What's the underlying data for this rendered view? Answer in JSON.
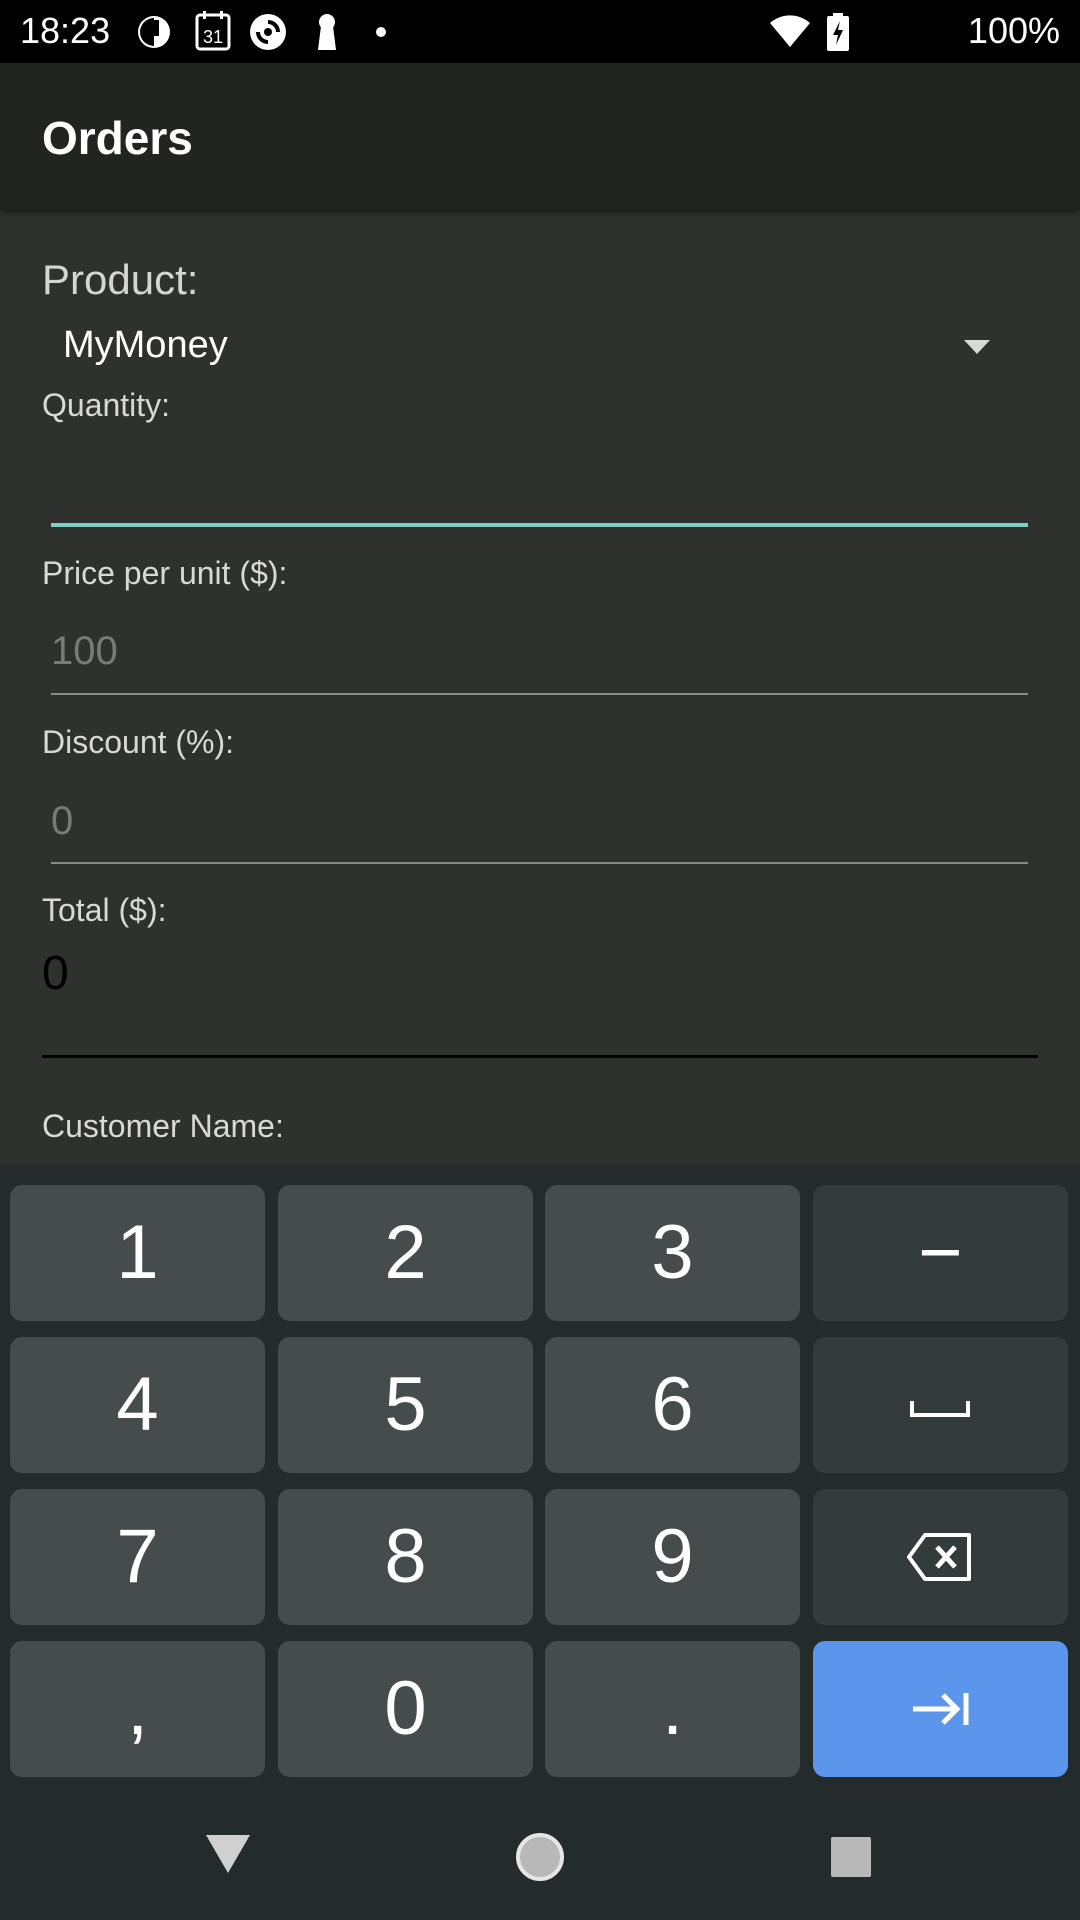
{
  "status_bar": {
    "time": "18:23",
    "battery": "100%",
    "left_icons": [
      "data-saver-icon",
      "calendar-icon",
      "sync-icon",
      "keyhole-icon",
      "notification-dot-icon"
    ],
    "calendar_day": "31",
    "right_icons": [
      "wifi-icon",
      "battery-charging-icon"
    ]
  },
  "app_bar": {
    "title": "Orders"
  },
  "form": {
    "product_label": "Product:",
    "product_value": "MyMoney",
    "quantity_label": "Quantity:",
    "quantity_value": "",
    "price_label": "Price per unit ($):",
    "price_hint": "100",
    "discount_label": "Discount (%):",
    "discount_hint": "0",
    "total_label": "Total ($):",
    "total_value": "0",
    "customer_label": "Customer Name:"
  },
  "keyboard": {
    "keys": [
      {
        "label": "1"
      },
      {
        "label": "2"
      },
      {
        "label": "3"
      },
      {
        "label": "−"
      },
      {
        "label": "4"
      },
      {
        "label": "5"
      },
      {
        "label": "6"
      },
      {
        "label": "space-icon"
      },
      {
        "label": "7"
      },
      {
        "label": "8"
      },
      {
        "label": "9"
      },
      {
        "label": "backspace-icon"
      },
      {
        "label": ","
      },
      {
        "label": "0"
      },
      {
        "label": "."
      },
      {
        "label": "next-tab-icon"
      }
    ]
  },
  "nav_bar": {
    "icons": [
      "back-icon",
      "home-icon",
      "recents-icon"
    ]
  },
  "colors": {
    "status_bar_bg": "#000000",
    "app_bar_bg": "#222421",
    "content_bg": "#2f312e",
    "focus_accent": "#7fd0c4",
    "keyboard_bg": "#232b2d",
    "key_bg": "#464c4c",
    "func_key_bg": "#343b3c",
    "action_key_bg": "#5b95ec"
  }
}
